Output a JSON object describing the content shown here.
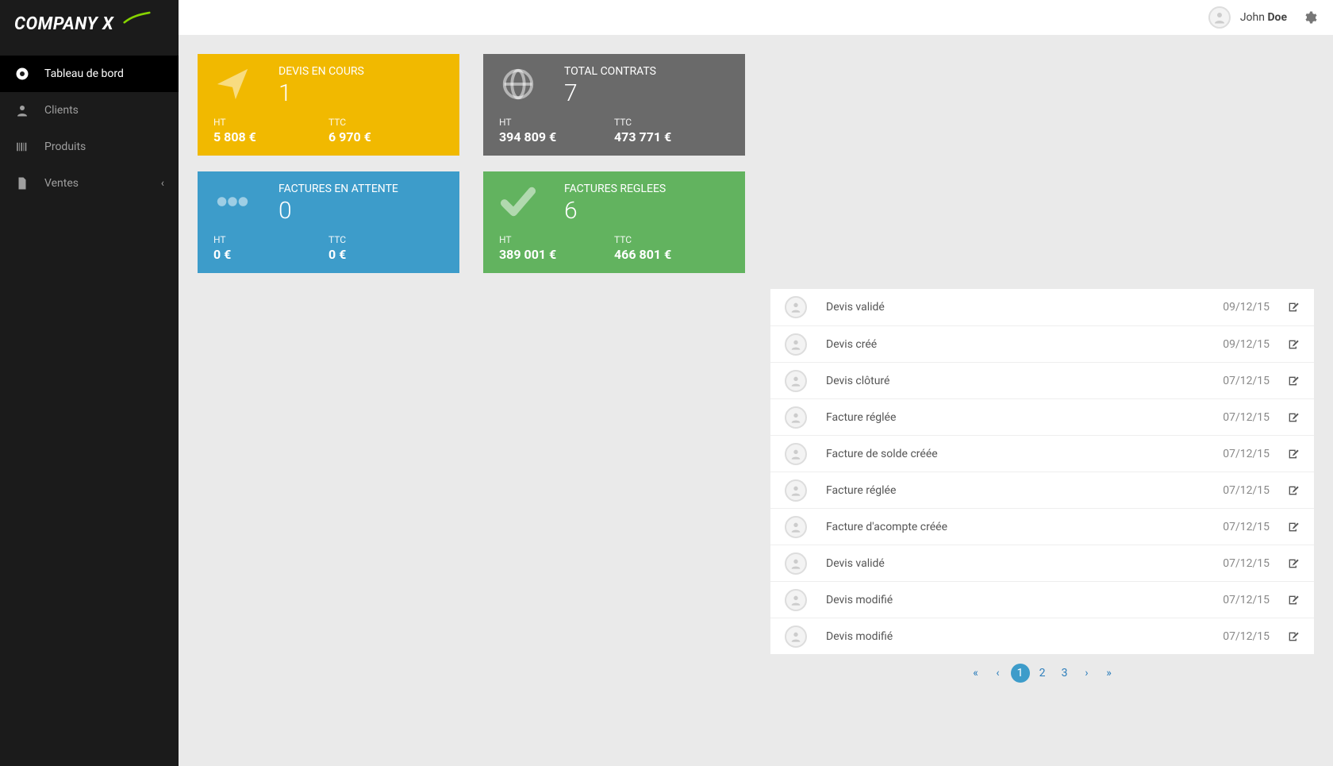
{
  "brand": {
    "name": "COMPANY X"
  },
  "topbar": {
    "user_first": "John ",
    "user_last": "Doe"
  },
  "sidebar": {
    "items": [
      {
        "label": "Tableau de bord",
        "iconName": "dashboard-icon",
        "active": true,
        "expandable": false
      },
      {
        "label": "Clients",
        "iconName": "user-icon",
        "active": false,
        "expandable": false
      },
      {
        "label": "Produits",
        "iconName": "barcode-icon",
        "active": false,
        "expandable": false
      },
      {
        "label": "Ventes",
        "iconName": "file-icon",
        "active": false,
        "expandable": true
      }
    ]
  },
  "cards": [
    {
      "color": "yellow",
      "iconName": "paper-plane-icon",
      "title": "DEVIS EN COURS",
      "count": "1",
      "stats": [
        {
          "label": "HT",
          "value": "5 808 €"
        },
        {
          "label": "TTC",
          "value": "6 970 €"
        }
      ]
    },
    {
      "color": "gray",
      "iconName": "globe-icon",
      "title": "TOTAL CONTRATS",
      "count": "7",
      "stats": [
        {
          "label": "HT",
          "value": "394 809 €"
        },
        {
          "label": "TTC",
          "value": "473 771 €"
        }
      ]
    },
    {
      "color": "blue",
      "iconName": "ellipsis-icon",
      "title": "FACTURES EN ATTENTE",
      "count": "0",
      "stats": [
        {
          "label": "HT",
          "value": "0 €"
        },
        {
          "label": "TTC",
          "value": "0 €"
        }
      ]
    },
    {
      "color": "green",
      "iconName": "check-icon",
      "title": "FACTURES REGLEES",
      "count": "6",
      "stats": [
        {
          "label": "HT",
          "value": "389 001 €"
        },
        {
          "label": "TTC",
          "value": "466 801 €"
        }
      ]
    }
  ],
  "feed": [
    {
      "title": "Devis validé",
      "date": "09/12/15"
    },
    {
      "title": "Devis créé",
      "date": "09/12/15"
    },
    {
      "title": "Devis clôturé",
      "date": "07/12/15"
    },
    {
      "title": "Facture réglée",
      "date": "07/12/15"
    },
    {
      "title": "Facture de solde créée",
      "date": "07/12/15"
    },
    {
      "title": "Facture réglée",
      "date": "07/12/15"
    },
    {
      "title": "Facture d'acompte créée",
      "date": "07/12/15"
    },
    {
      "title": "Devis validé",
      "date": "07/12/15"
    },
    {
      "title": "Devis modifié",
      "date": "07/12/15"
    },
    {
      "title": "Devis modifié",
      "date": "07/12/15"
    }
  ],
  "pagination": {
    "first": "«",
    "prev": "‹",
    "pages": [
      "1",
      "2",
      "3"
    ],
    "active": "1",
    "next": "›",
    "last": "»"
  }
}
